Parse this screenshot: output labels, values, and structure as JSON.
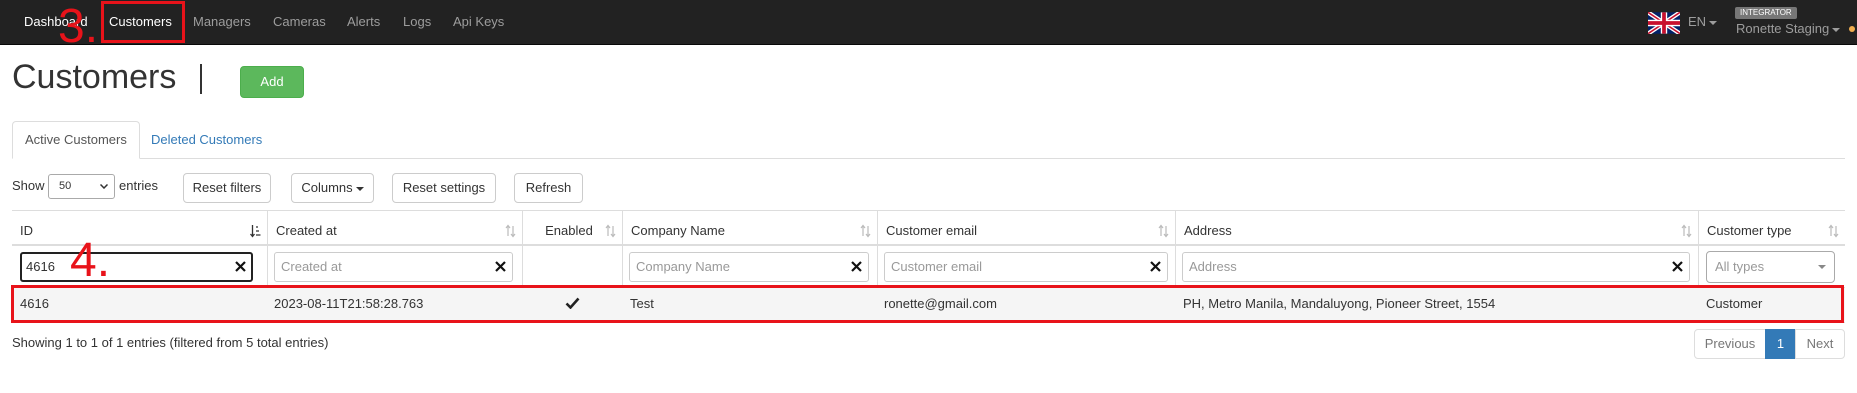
{
  "nav": {
    "items": [
      {
        "label": "Dashboard",
        "key": "dashboard"
      },
      {
        "label": "Customers",
        "key": "customers"
      },
      {
        "label": "Managers",
        "key": "managers"
      },
      {
        "label": "Cameras",
        "key": "cameras"
      },
      {
        "label": "Alerts",
        "key": "alerts"
      },
      {
        "label": "Logs",
        "key": "logs"
      },
      {
        "label": "Api Keys",
        "key": "api-keys"
      }
    ],
    "active": "Customers",
    "language": "EN",
    "flag_icon": "uk-flag-icon",
    "role_badge": "INTEGRATOR",
    "user": "Ronette Staging",
    "notification_color": "#f0ad4e"
  },
  "annotations": {
    "step3": "3.",
    "step4": "4.",
    "color": "#e8131a"
  },
  "page": {
    "title": "Customers",
    "add_label": "Add"
  },
  "tabs": {
    "active": "Active Customers",
    "deleted": "Deleted Customers"
  },
  "toolbar": {
    "show_label": "Show",
    "entries_value": "50",
    "entries_label": "entries",
    "reset_filters": "Reset filters",
    "columns": "Columns",
    "reset_settings": "Reset settings",
    "refresh": "Refresh"
  },
  "table": {
    "columns": {
      "id": "ID",
      "created_at": "Created at",
      "enabled": "Enabled",
      "company_name": "Company Name",
      "customer_email": "Customer email",
      "address": "Address",
      "customer_type": "Customer type"
    },
    "filters": {
      "id_value": "4616",
      "created_at_placeholder": "Created at",
      "company_name_placeholder": "Company Name",
      "customer_email_placeholder": "Customer email",
      "address_placeholder": "Address",
      "customer_type_placeholder": "All types"
    },
    "rows": [
      {
        "id": "4616",
        "created_at": "2023-08-11T21:58:28.763",
        "enabled_icon": "check-icon",
        "company_name": "Test",
        "customer_email": "ronette@gmail.com",
        "address": "PH, Metro Manila, Mandaluyong, Pioneer Street, 1554",
        "customer_type": "Customer"
      }
    ]
  },
  "footer": {
    "info": "Showing 1 to 1 of 1 entries (filtered from 5 total entries)",
    "previous": "Previous",
    "current_page": "1",
    "next": "Next"
  },
  "colors": {
    "navbar": "#222222",
    "add_button": "#5cb85c",
    "link": "#337ab7",
    "annotation": "#e8131a"
  }
}
